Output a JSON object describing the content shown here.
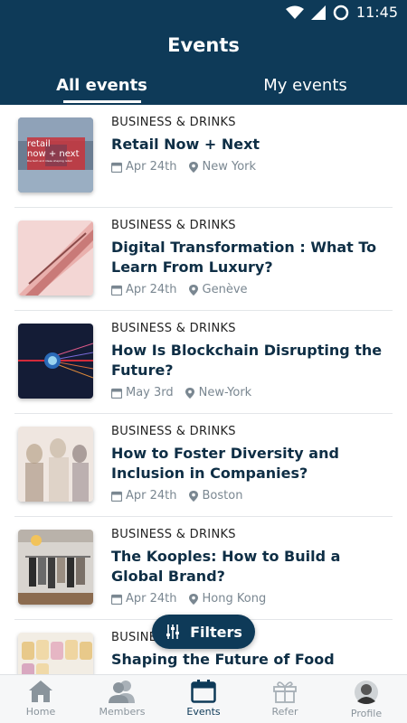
{
  "status_bar": {
    "time": "11:45"
  },
  "header": {
    "title": "Events"
  },
  "tabs": [
    {
      "label": "All events",
      "active": true
    },
    {
      "label": "My events",
      "active": false
    }
  ],
  "events": [
    {
      "category": "BUSINESS & DRINKS",
      "title": "Retail Now + Next",
      "date": "Apr 24th",
      "location": "New York",
      "thumb_text_1": "retail",
      "thumb_text_2": "now + next",
      "thumb_text_3": "the tech and ideas shaping retail"
    },
    {
      "category": "BUSINESS & DRINKS",
      "title": "Digital Transformation : What To Learn From Luxury?",
      "date": "Apr 24th",
      "location": "Genève"
    },
    {
      "category": "BUSINESS & DRINKS",
      "title": "How Is Blockchain Disrupting the Future?",
      "date": "May 3rd",
      "location": "New-York"
    },
    {
      "category": "BUSINESS & DRINKS",
      "title": "How to Foster Diversity and Inclusion in Companies?",
      "date": "Apr 24th",
      "location": "Boston"
    },
    {
      "category": "BUSINESS & DRINKS",
      "title": "The Kooples: How to Build a Global Brand?",
      "date": "Apr 24th",
      "location": "Hong Kong"
    },
    {
      "category": "BUSINESS & DRINKS",
      "title": "Shaping the Future of Food"
    }
  ],
  "filters_button": {
    "label": "Filters"
  },
  "bottom_nav": [
    {
      "label": "Home",
      "icon": "home-icon",
      "active": false
    },
    {
      "label": "Members",
      "icon": "members-icon",
      "active": false
    },
    {
      "label": "Events",
      "icon": "calendar-icon",
      "active": true
    },
    {
      "label": "Refer",
      "icon": "gift-icon",
      "active": false
    },
    {
      "label": "Profile",
      "icon": "avatar",
      "active": false
    }
  ],
  "colors": {
    "primary": "#0e3a58",
    "muted": "#8a949c"
  }
}
